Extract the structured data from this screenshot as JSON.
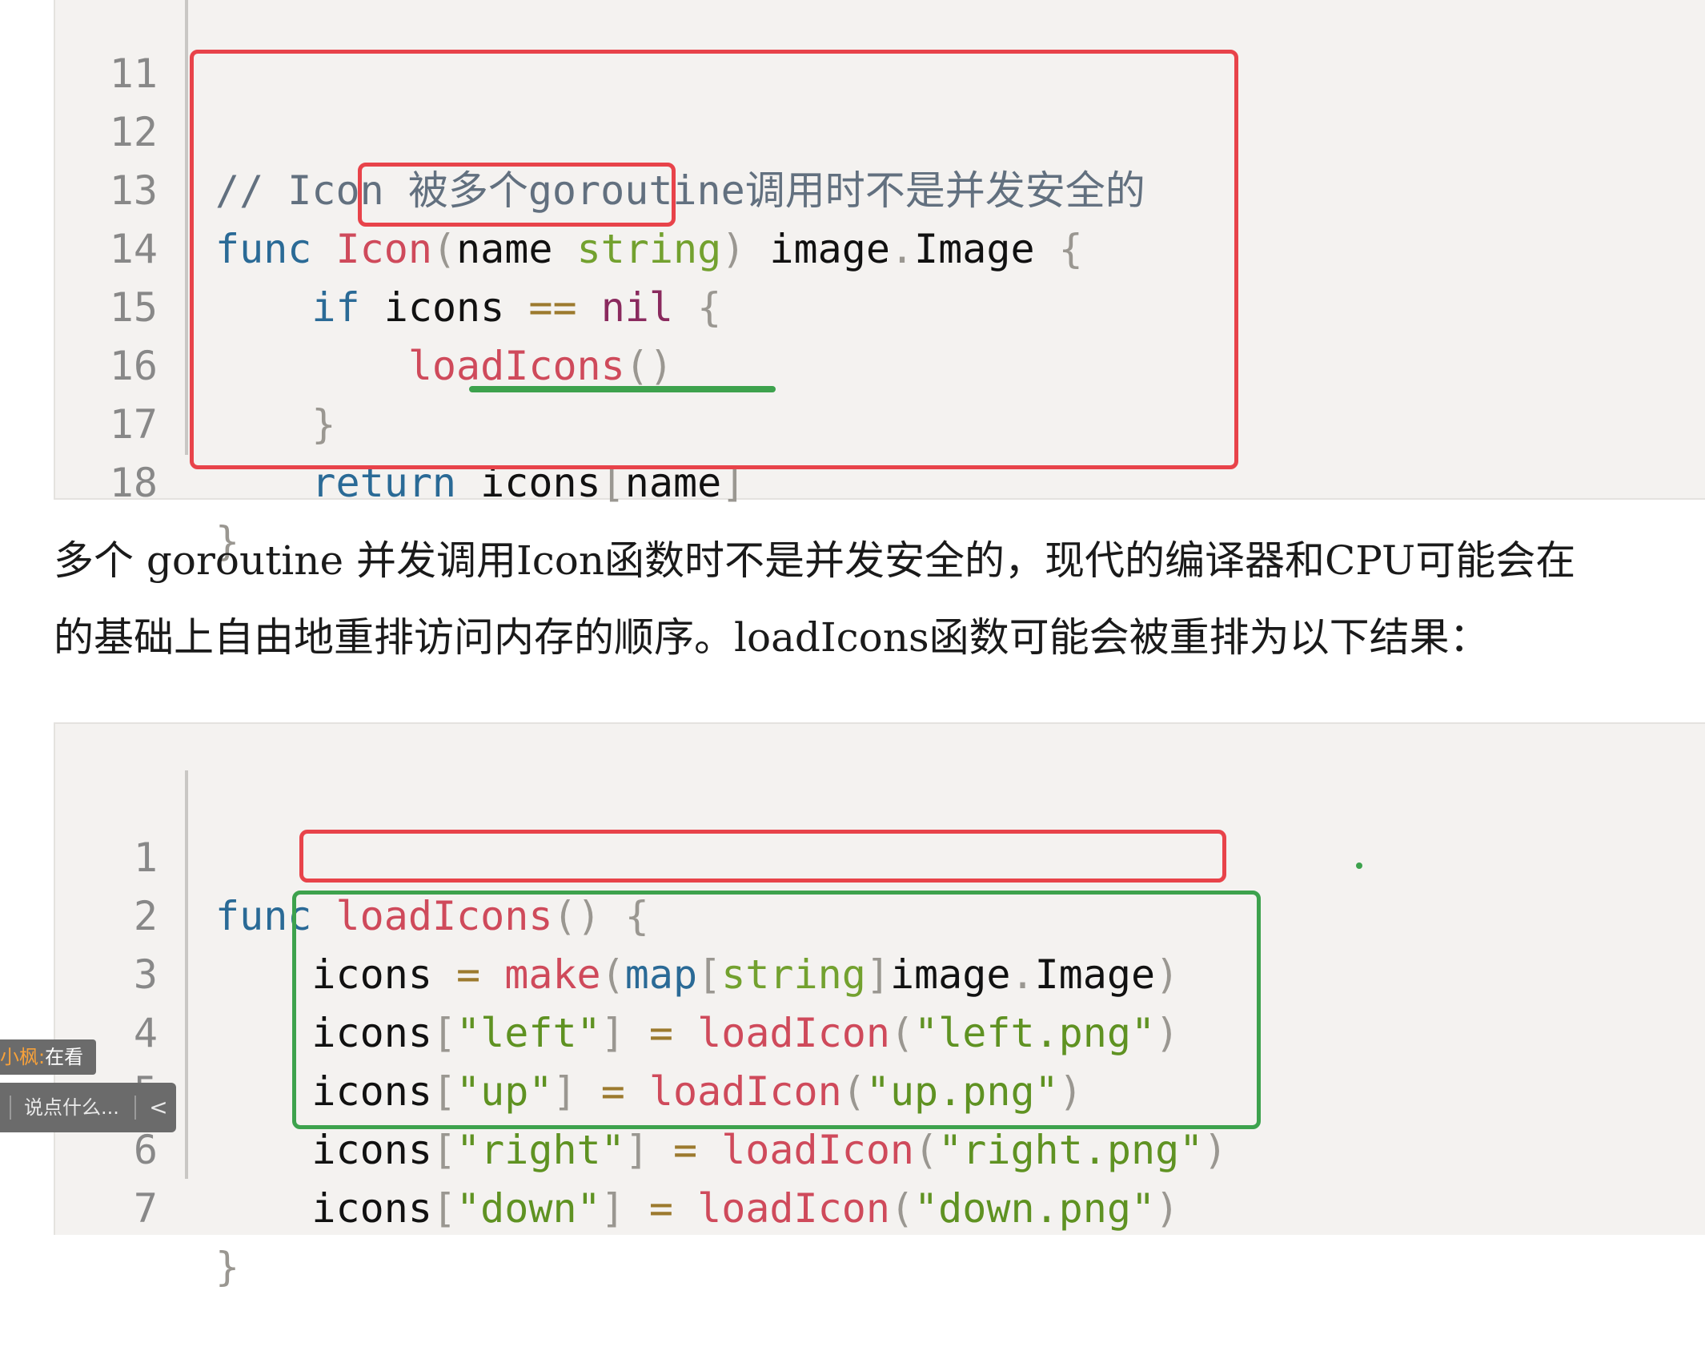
{
  "code_block_1": {
    "lines": [
      {
        "num": "11",
        "code": ""
      },
      {
        "num": "12",
        "code": "// Icon 被多个goroutine调用时不是并发安全的"
      },
      {
        "num": "13",
        "code": "func Icon(name string) image.Image {"
      },
      {
        "num": "14",
        "code": "    if icons == nil {"
      },
      {
        "num": "15",
        "code": "        loadIcons()"
      },
      {
        "num": "16",
        "code": "    }"
      },
      {
        "num": "17",
        "code": "    return icons[name]"
      },
      {
        "num": "18",
        "code": "}"
      }
    ]
  },
  "paragraph": {
    "line1": "多个 goroutine 并发调用Icon函数时不是并发安全的，现代的编译器和CPU可能会在",
    "line2": "的基础上自由地重排访问内存的顺序。loadIcons函数可能会被重排为以下结果："
  },
  "code_block_2": {
    "lines": [
      {
        "num": "1",
        "code": "func loadIcons() {"
      },
      {
        "num": "2",
        "code": "    icons = make(map[string]image.Image)"
      },
      {
        "num": "3",
        "code": "    icons[\"left\"] = loadIcon(\"left.png\")"
      },
      {
        "num": "4",
        "code": "    icons[\"up\"] = loadIcon(\"up.png\")"
      },
      {
        "num": "5",
        "code": "    icons[\"right\"] = loadIcon(\"right.png\")"
      },
      {
        "num": "6",
        "code": "    icons[\"down\"] = loadIcon(\"down.png\")"
      },
      {
        "num": "7",
        "code": "}"
      }
    ]
  },
  "overlay": {
    "viewer_name": "小枫:",
    "viewer_status": "在看",
    "comment_placeholder": "说点什么...",
    "collapse_glyph": "<"
  },
  "colors": {
    "keyword": "#2a6a96",
    "function": "#cf4a5b",
    "type": "#73a12f",
    "string": "#5f9222",
    "highlight_red": "#e8434a",
    "highlight_green": "#3da24d",
    "code_bg": "#f4f2f0"
  }
}
